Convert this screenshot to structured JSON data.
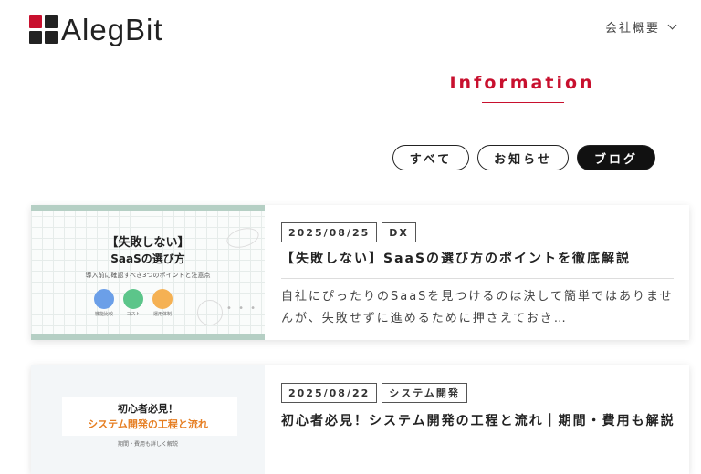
{
  "header": {
    "logo_text": "AlegBit",
    "nav_label": "会社概要"
  },
  "section": {
    "title": "Information"
  },
  "filters": [
    {
      "label": "すべて",
      "active": false
    },
    {
      "label": "お知らせ",
      "active": false
    },
    {
      "label": "ブログ",
      "active": true
    }
  ],
  "posts": [
    {
      "date": "2025/08/25",
      "category": "DX",
      "title": "【失敗しない】SaaSの選び方のポイントを徹底解説",
      "excerpt": "自社にぴったりのSaaSを見つけるのは決して簡単ではありませんが、失敗せずに進めるために押さえておき…",
      "thumb": {
        "line1": "【失敗しない】",
        "line2": "SaaSの選び方",
        "line3": "導入前に確認すべき3つのポイントと注意点",
        "labels": [
          "機能比較",
          "コスト",
          "運用体制"
        ],
        "colors": [
          "#6b9fe8",
          "#5cc58a",
          "#f5b153"
        ]
      }
    },
    {
      "date": "2025/08/22",
      "category": "システム開発",
      "title": "初心者必見！システム開発の工程と流れ｜期間・費用も解説",
      "thumb": {
        "line1": "初心者必見！",
        "line2": "システム開発の工程と流れ",
        "line3": "期間・費用も詳しく解説"
      }
    }
  ],
  "colors": {
    "accent": "#c8102e",
    "band": "#b5cfc4",
    "orange": "#e67e22"
  }
}
